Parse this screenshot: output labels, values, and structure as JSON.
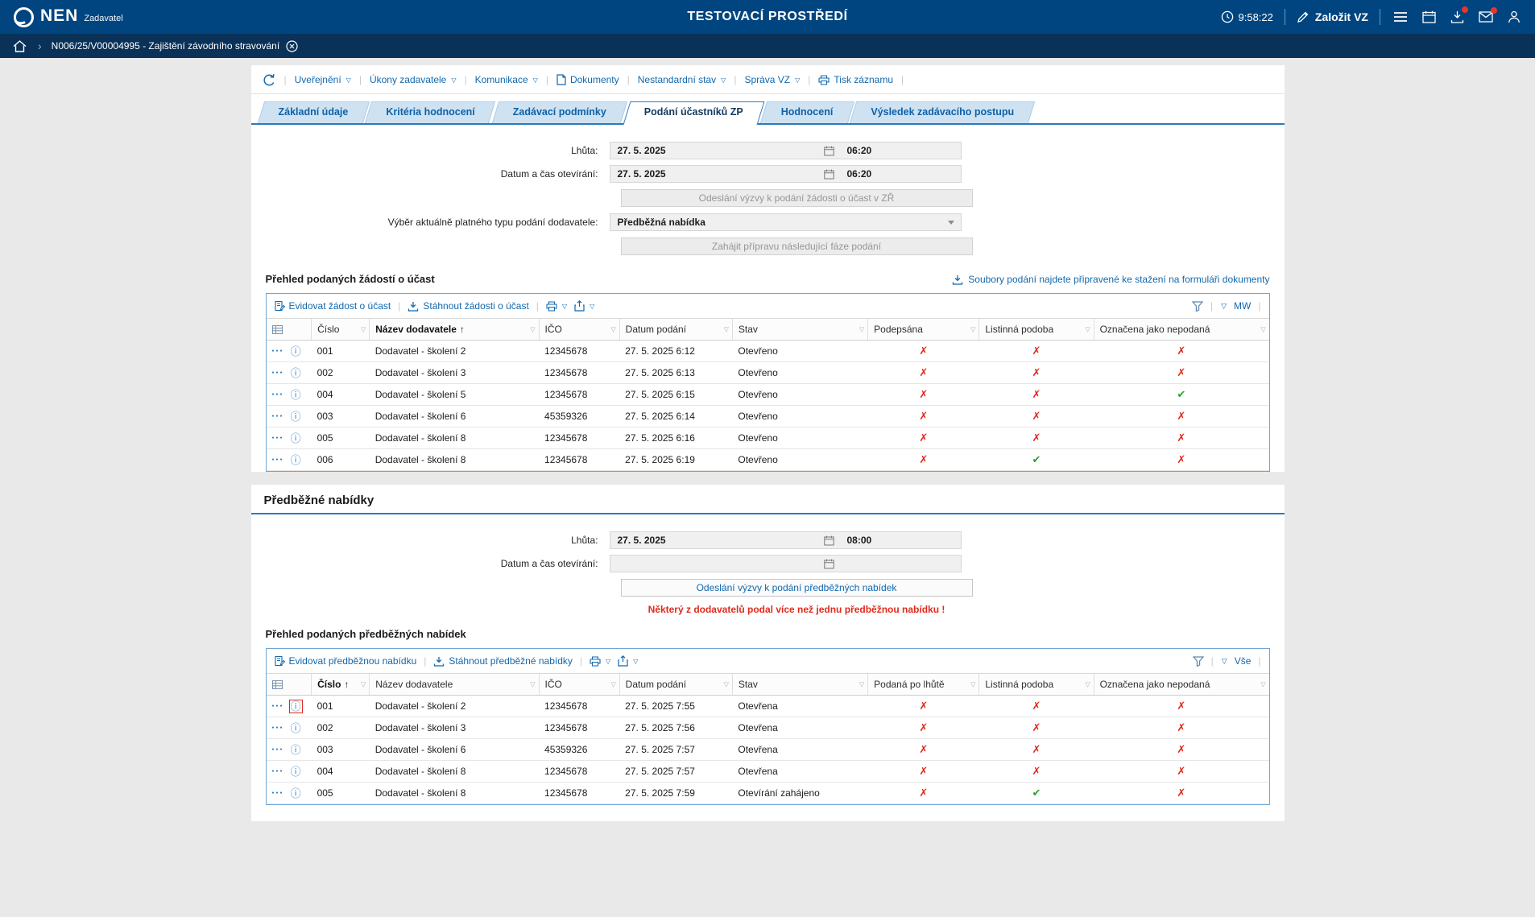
{
  "colors": {
    "header_bg": "#00457f",
    "breadcrumb_bg": "#0a3158",
    "accent_blue": "#1268ad",
    "tab_line": "#2b79bd",
    "tab_bg": "#cfe2f2",
    "cross_red": "#e02a1d",
    "check_green": "#2fa12b",
    "grid_border": "#6ea6d6"
  },
  "icons": {
    "caret": "▽",
    "cross": "✗",
    "check": "✔",
    "sort_asc": "↑",
    "row_menu": "●●●",
    "info": "ⓘ",
    "chevron": "›"
  },
  "header": {
    "brand": "NEN",
    "brand_sub": "Zadavatel",
    "env_title": "TESTOVACÍ PROSTŘEDÍ",
    "clock": "9:58:22",
    "new_vz_label": "Založit VZ"
  },
  "breadcrumb": {
    "record": "N006/25/V00004995 - Zajištění závodního stravování"
  },
  "actions_toolbar": {
    "uverejneni": "Uveřejnění",
    "ukony": "Úkony zadavatele",
    "komunikace": "Komunikace",
    "dokumenty": "Dokumenty",
    "nestandardni": "Nestandardní stav",
    "sprava": "Správa VZ",
    "tisk": "Tisk záznamu"
  },
  "tabs": {
    "items": [
      {
        "label": "Základní údaje",
        "active": false
      },
      {
        "label": "Kritéria hodnocení",
        "active": false
      },
      {
        "label": "Zadávací podmínky",
        "active": false
      },
      {
        "label": "Podání účastníků ZP",
        "active": true
      },
      {
        "label": "Hodnocení",
        "active": false
      },
      {
        "label": "Výsledek zadávacího postupu",
        "active": false
      }
    ]
  },
  "participation": {
    "deadline_label": "Lhůta:",
    "deadline_date": "27. 5. 2025",
    "deadline_time": "06:20",
    "opening_label": "Datum a čas otevírání:",
    "opening_date": "27. 5. 2025",
    "opening_time": "06:20",
    "send_request_button": "Odeslání výzvy k podání žádosti o účast v ZŘ",
    "type_label": "Výběr aktuálně platného typu podání dodavatele:",
    "type_value": "Předběžná nabídka",
    "next_phase_button": "Zahájit přípravu následující fáze podání",
    "overview_title": "Přehled podaných žádostí o účast",
    "files_link": "Soubory podání najdete připravené ke stažení na formuláři dokumenty"
  },
  "requests_table": {
    "toolbar": {
      "register": "Evidovat žádost o účast",
      "download": "Stáhnout žádosti o účast",
      "scope": "MW"
    },
    "columns": [
      "Číslo",
      "Název dodavatele",
      "IČO",
      "Datum podání",
      "Stav",
      "Podepsána",
      "Listinná podoba",
      "Označena jako nepodaná"
    ],
    "sort_column": 1,
    "rows": [
      {
        "values": [
          "001",
          "Dodavatel - školení 2",
          "12345678",
          "27. 5. 2025 6:12",
          "Otevřeno"
        ],
        "flags": [
          "no",
          "no",
          "no"
        ]
      },
      {
        "values": [
          "002",
          "Dodavatel - školení 3",
          "12345678",
          "27. 5. 2025 6:13",
          "Otevřeno"
        ],
        "flags": [
          "no",
          "no",
          "no"
        ]
      },
      {
        "values": [
          "004",
          "Dodavatel - školení 5",
          "12345678",
          "27. 5. 2025 6:15",
          "Otevřeno"
        ],
        "flags": [
          "no",
          "no",
          "yes"
        ]
      },
      {
        "values": [
          "003",
          "Dodavatel - školení 6",
          "45359326",
          "27. 5. 2025 6:14",
          "Otevřeno"
        ],
        "flags": [
          "no",
          "no",
          "no"
        ]
      },
      {
        "values": [
          "005",
          "Dodavatel - školení 8",
          "12345678",
          "27. 5. 2025 6:16",
          "Otevřeno"
        ],
        "flags": [
          "no",
          "no",
          "no"
        ]
      },
      {
        "values": [
          "006",
          "Dodavatel - školení 8",
          "12345678",
          "27. 5. 2025 6:19",
          "Otevřeno"
        ],
        "flags": [
          "no",
          "yes",
          "no"
        ]
      }
    ]
  },
  "preliminary": {
    "section_title": "Předběžné nabídky",
    "deadline_label": "Lhůta:",
    "deadline_date": "27. 5. 2025",
    "deadline_time": "08:00",
    "opening_label": "Datum a čas otevírání:",
    "opening_date": "",
    "opening_time": "",
    "send_button": "Odeslání výzvy k podání předběžných nabídek",
    "warning": "Některý z dodavatelů podal více než jednu předběžnou nabídku !",
    "overview_title": "Přehled podaných předběžných nabídek"
  },
  "offers_table": {
    "toolbar": {
      "register": "Evidovat předběžnou nabídku",
      "download": "Stáhnout předběžné nabídky",
      "scope": "Vše"
    },
    "columns": [
      "Číslo",
      "Název dodavatele",
      "IČO",
      "Datum podání",
      "Stav",
      "Podaná po lhůtě",
      "Listinná podoba",
      "Označena jako nepodaná"
    ],
    "sort_column": 0,
    "rows": [
      {
        "values": [
          "001",
          "Dodavatel - školení 2",
          "12345678",
          "27. 5. 2025 7:55",
          "Otevřena"
        ],
        "flags": [
          "no",
          "no",
          "no"
        ],
        "info_boxed": true
      },
      {
        "values": [
          "002",
          "Dodavatel - školení 3",
          "12345678",
          "27. 5. 2025 7:56",
          "Otevřena"
        ],
        "flags": [
          "no",
          "no",
          "no"
        ]
      },
      {
        "values": [
          "003",
          "Dodavatel - školení 6",
          "45359326",
          "27. 5. 2025 7:57",
          "Otevřena"
        ],
        "flags": [
          "no",
          "no",
          "no"
        ]
      },
      {
        "values": [
          "004",
          "Dodavatel - školení 8",
          "12345678",
          "27. 5. 2025 7:57",
          "Otevřena"
        ],
        "flags": [
          "no",
          "no",
          "no"
        ]
      },
      {
        "values": [
          "005",
          "Dodavatel - školení 8",
          "12345678",
          "27. 5. 2025 7:59",
          "Otevírání zahájeno"
        ],
        "flags": [
          "no",
          "yes",
          "no"
        ]
      }
    ]
  }
}
